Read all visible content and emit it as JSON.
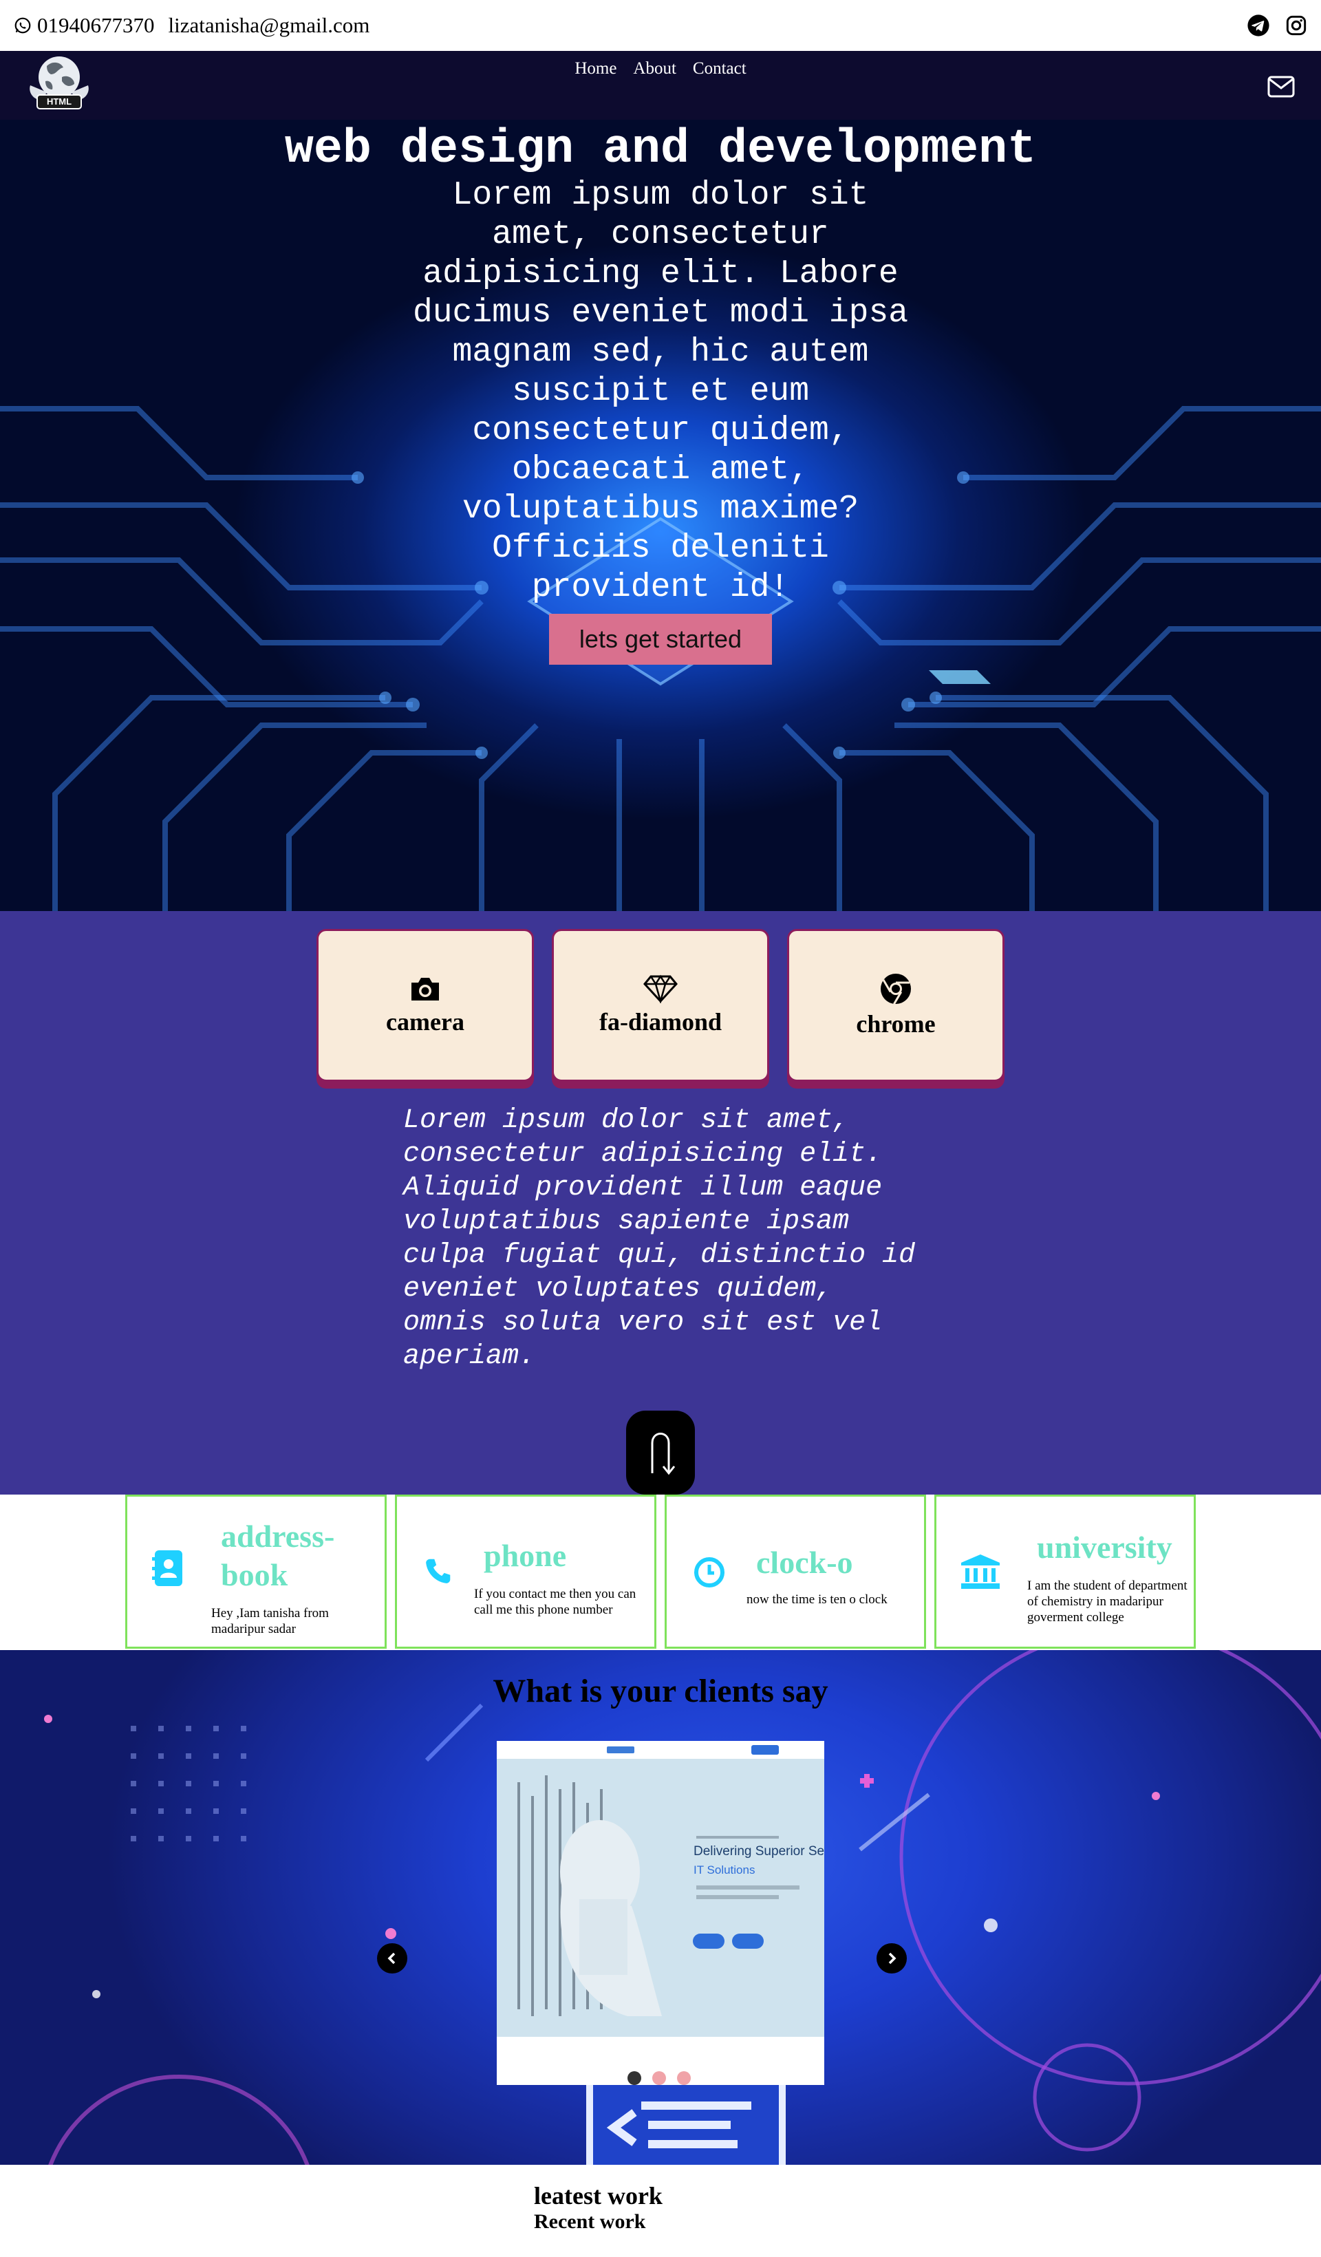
{
  "topbar": {
    "phone": "01940677370",
    "email": "lizatanisha@gmail.com",
    "icons": [
      "whatsapp-icon",
      "telegram-icon",
      "instagram-icon"
    ]
  },
  "nav": {
    "logo_text": "HTML",
    "items": [
      {
        "label": "Home"
      },
      {
        "label": "About"
      },
      {
        "label": "Contact"
      }
    ],
    "mail_icon": "envelope-icon"
  },
  "hero": {
    "title": "web design and development",
    "text": "Lorem ipsum dolor sit amet, consectetur adipisicing elit. Labore ducimus eveniet modi ipsa magnam sed, hic autem suscipit et eum consectetur quidem, obcaecati amet, voluptatibus maxime? Officiis deleniti provident id!",
    "button": "lets get started"
  },
  "features": {
    "cards": [
      {
        "label": "camera",
        "icon": "camera-icon"
      },
      {
        "label": "fa-diamond",
        "icon": "diamond-icon"
      },
      {
        "label": "chrome",
        "icon": "chrome-icon"
      }
    ],
    "text": "Lorem ipsum dolor sit amet, consectetur adipisicing elit. Aliquid provident illum eaque voluptatibus sapiente ipsam culpa fugiat qui, distinctio id eveniet voluptates quidem, omnis soluta vero sit est vel aperiam."
  },
  "info": [
    {
      "title": "address-book",
      "desc": "Hey ,Iam tanisha from madaripur sadar",
      "icon": "address-book-icon"
    },
    {
      "title": "phone",
      "desc": "If you contact me then you can call me this phone number",
      "icon": "phone-icon"
    },
    {
      "title": "clock-o",
      "desc": "now the time is ten o clock",
      "icon": "clock-icon"
    },
    {
      "title": "university",
      "desc": "I am the student of department of chemistry in madaripur goverment college",
      "icon": "university-icon"
    }
  ],
  "clients": {
    "heading": "What is your clients say",
    "slide": {
      "headline": "Delivering Superior Ser",
      "subline": "IT Solutions"
    },
    "dots": 3
  },
  "latest": {
    "heading": "leatest work",
    "subheading": "Recent work"
  }
}
